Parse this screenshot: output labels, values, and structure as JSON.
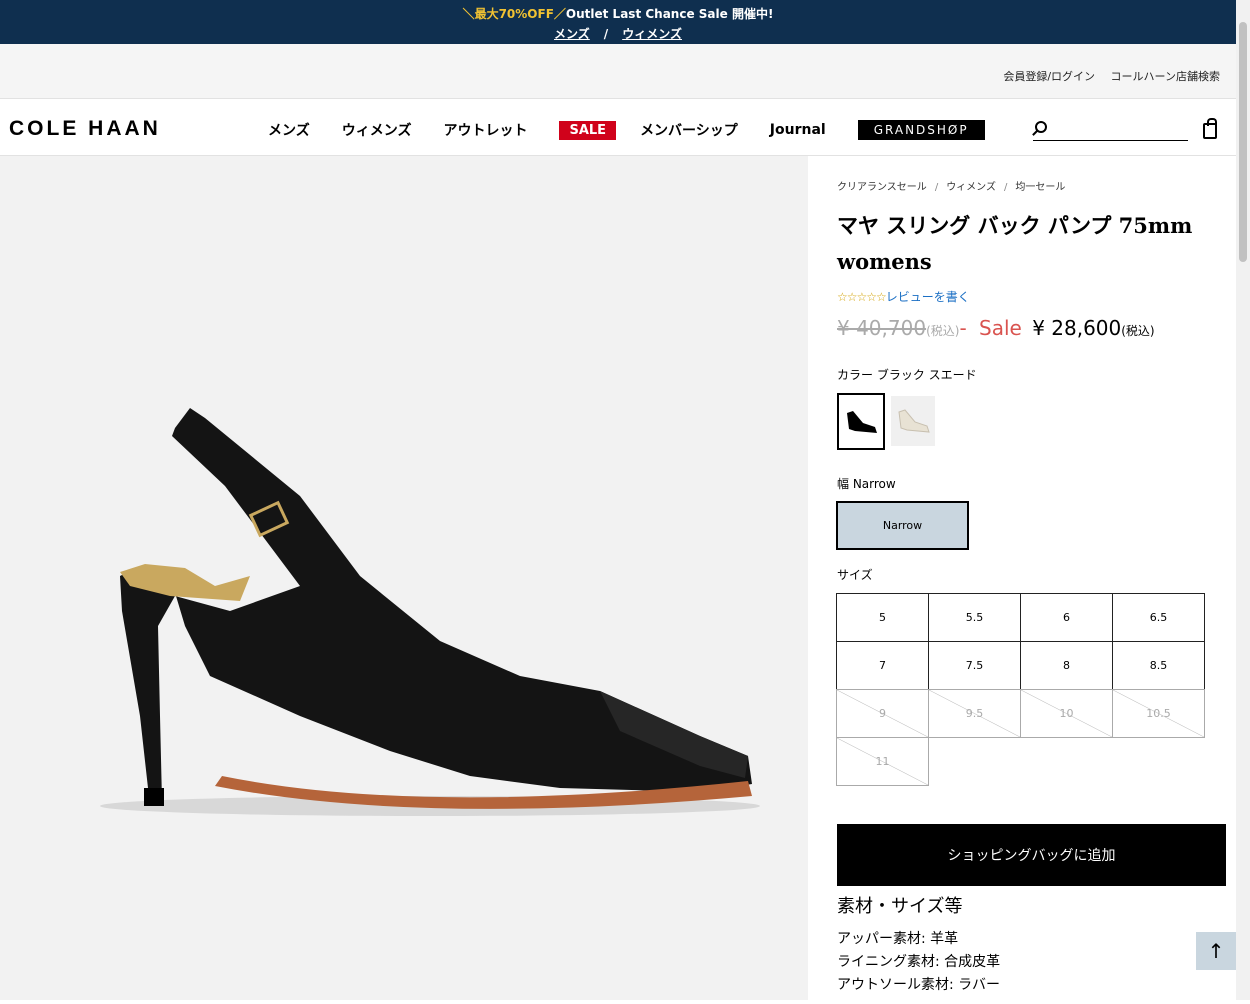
{
  "promo": {
    "prefix": "＼最大70%OFF／",
    "text": "Outlet Last Chance Sale 開催中!",
    "links": [
      "メンズ",
      "/",
      "ウィメンズ"
    ]
  },
  "topbar": {
    "login": "会員登録/ログイン",
    "stores": "コールハーン店舗検索"
  },
  "header": {
    "logo": "COLE HAAN",
    "menu": [
      "メンズ",
      "ウィメンズ",
      "アウトレット"
    ],
    "sale": "SALE",
    "menu2": [
      "メンバーシップ",
      "Journal"
    ],
    "grandshop": "GRANDSHØP",
    "search_placeholder": ""
  },
  "breadcrumb": [
    "クリアランスセール",
    "ウィメンズ",
    "均一セール"
  ],
  "product": {
    "title": "マヤ スリング バック パンプ 75mm womens",
    "stars": "☆☆☆☆☆",
    "review_link": "レビューを書く",
    "old_price": "¥ 40,700",
    "old_tax": "(税込)",
    "dash": "-",
    "sale_label": "Sale",
    "new_price": "¥ 28,600",
    "new_tax": "(税込)",
    "color_label": "カラー ブラック スエード",
    "width_label": "幅 Narrow",
    "width_option": "Narrow",
    "size_label": "サイズ",
    "sizes": [
      {
        "label": "5",
        "available": true
      },
      {
        "label": "5.5",
        "available": true
      },
      {
        "label": "6",
        "available": true
      },
      {
        "label": "6.5",
        "available": true
      },
      {
        "label": "7",
        "available": true
      },
      {
        "label": "7.5",
        "available": true
      },
      {
        "label": "8",
        "available": true
      },
      {
        "label": "8.5",
        "available": true
      },
      {
        "label": "9",
        "available": false
      },
      {
        "label": "9.5",
        "available": false
      },
      {
        "label": "10",
        "available": false
      },
      {
        "label": "10.5",
        "available": false
      },
      {
        "label": "11",
        "available": false
      }
    ],
    "add_to_bag": "ショッピングバッグに追加",
    "material_title": "素材・サイズ等",
    "materials": [
      "アッパー素材: 羊革",
      "ライニング素材: 合成皮革",
      "アウトソール素材: ラバー"
    ]
  },
  "back_to_top": "↑",
  "colors": {
    "promo_bg": "#0f2f4f",
    "sale_red": "#d0021b",
    "accent_blue": "#c9d6df"
  }
}
